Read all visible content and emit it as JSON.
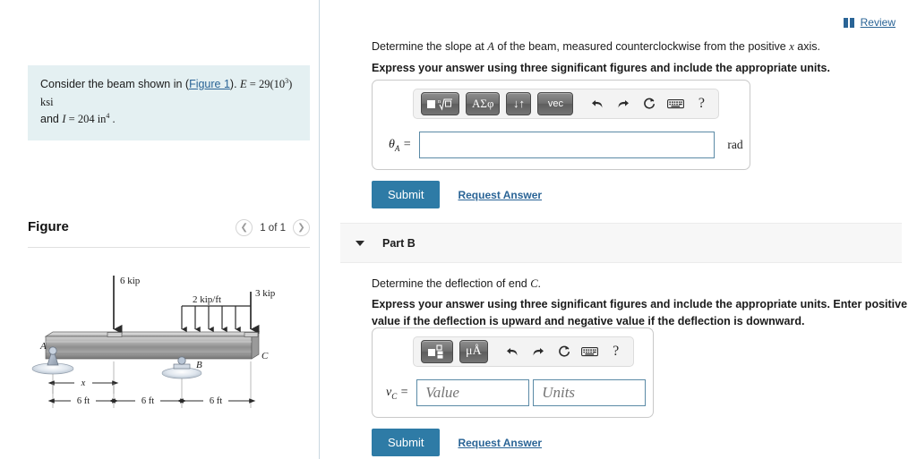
{
  "left": {
    "prompt": {
      "lead": "Consider the beam shown in (",
      "figure_link": "Figure 1",
      "after_link": "). ",
      "E_symbol": "E",
      "E_value": " = 29(10",
      "E_exp": "3",
      "E_units": ") ksi",
      "line2_lead": "and ",
      "I_symbol": "I",
      "I_value": " = 204  in",
      "I_exp": "4",
      "line2_tail": " ."
    },
    "figure": {
      "title": "Figure",
      "count": "1 of 1",
      "prev_icon": "chevron-left-icon",
      "next_icon": "chevron-right-icon",
      "diagram": {
        "point_load_1": "6 kip",
        "distributed_load": "2 kip/ft",
        "point_load_2": "3 kip",
        "support_a": "A",
        "support_b": "B",
        "end_c": "C",
        "x_label": "x",
        "span_1": "6 ft",
        "span_2": "6 ft",
        "span_3": "6 ft"
      }
    }
  },
  "right": {
    "review": {
      "label": "Review",
      "icon": "book-icon"
    },
    "part_a": {
      "question": "Determine the slope at A of the beam, measured counterclockwise from the positive x axis.",
      "question_pre": "Determine the slope at ",
      "question_var1": "A",
      "question_mid": " of the beam, measured counterclockwise from the positive ",
      "question_var2": "x",
      "question_post": " axis.",
      "instruction": "Express your answer using three significant figures and include the appropriate units.",
      "toolbar": [
        {
          "name": "template-sqrt-button",
          "label": "■√□"
        },
        {
          "name": "greek-symbols-button",
          "label": "ΑΣφ"
        },
        {
          "name": "arrows-button",
          "label": "↓↑"
        },
        {
          "name": "vector-button",
          "label": "vec"
        },
        {
          "name": "undo-icon",
          "label": "↶"
        },
        {
          "name": "redo-icon",
          "label": "↷"
        },
        {
          "name": "reset-icon",
          "label": "↻"
        },
        {
          "name": "keyboard-icon",
          "label": "⌨"
        },
        {
          "name": "help-icon",
          "label": "?"
        }
      ],
      "answer_label_base": "θ",
      "answer_label_sub": "A",
      "answer_equals": " =",
      "answer_value": "",
      "answer_placeholder": "",
      "units_label": "rad",
      "submit_label": "Submit",
      "request_label": "Request Answer"
    },
    "part_b": {
      "header": "Part B",
      "caret_icon": "caret-down-icon",
      "question_pre": "Determine the deflection of end ",
      "question_var": "C",
      "question_post": ".",
      "instruction": "Express your answer using three significant figures and include the appropriate units. Enter positive value if the deflection is upward and negative value if the deflection is downward.",
      "toolbar": [
        {
          "name": "template-grid-button",
          "label": "▣"
        },
        {
          "name": "units-button",
          "label": "μÅ"
        },
        {
          "name": "undo-icon",
          "label": "↶"
        },
        {
          "name": "redo-icon",
          "label": "↷"
        },
        {
          "name": "reset-icon",
          "label": "↻"
        },
        {
          "name": "keyboard-icon",
          "label": "⌨"
        },
        {
          "name": "help-icon",
          "label": "?"
        }
      ],
      "answer_label_base": "v",
      "answer_label_sub": "C",
      "answer_equals": " =",
      "value_placeholder": "Value",
      "units_placeholder": "Units",
      "submit_label": "Submit",
      "request_label": "Request Answer"
    }
  },
  "colors": {
    "accent": "#2e7ba6",
    "link": "#2a6496",
    "prompt_bg": "#e4f0f2",
    "panel_border": "#c9c9c9",
    "input_border": "#5b8aa6"
  }
}
